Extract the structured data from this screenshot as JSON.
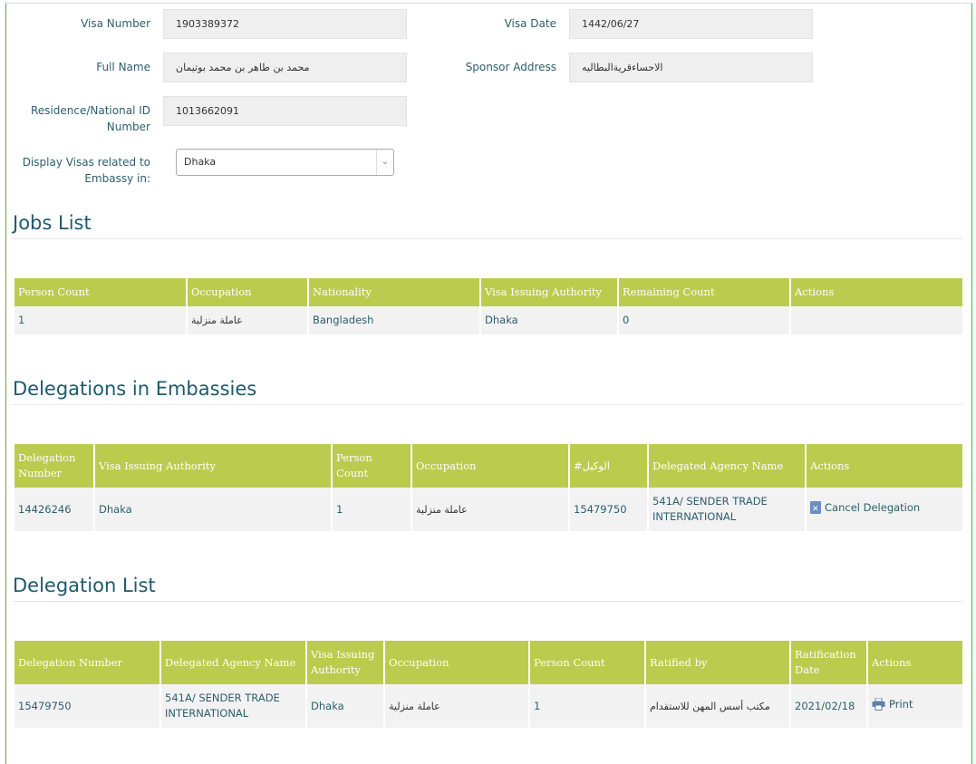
{
  "form": {
    "visa_number_label": "Visa Number",
    "visa_number": "1903389372",
    "visa_date_label": "Visa Date",
    "visa_date": "1442/06/27",
    "full_name_label": "Full Name",
    "full_name": "محمد بن طاهر بن محمد بوتيمان",
    "sponsor_address_label": "Sponsor Address",
    "sponsor_address": "الاحساءقريةالبطاليه",
    "residence_label_1": "Residence/National ID",
    "residence_label_2": "Number",
    "residence_id": "1013662091",
    "embassy_label_1": "Display Visas related to",
    "embassy_label_2": "Embassy in:",
    "embassy_selected": "Dhaka"
  },
  "jobs": {
    "title": "Jobs List",
    "headers": [
      "Person Count",
      "Occupation",
      "Nationality",
      "Visa Issuing Authority",
      "Remaining Count",
      "Actions"
    ],
    "rows": [
      [
        "1",
        "عاملة منزلية",
        "Bangladesh",
        "Dhaka",
        "0",
        ""
      ]
    ]
  },
  "embassy_delegations": {
    "title": "Delegations in Embassies",
    "headers": [
      "Delegation Number",
      "Visa Issuing Authority",
      "Person Count",
      "Occupation",
      "#الوكيل",
      "Delegated Agency Name",
      "Actions"
    ],
    "rows": [
      [
        "14426246",
        "Dhaka",
        "1",
        "عاملة منزلية",
        "15479750",
        "541A/ SENDER TRADE INTERNATIONAL",
        "Cancel Delegation"
      ]
    ]
  },
  "delegation_list": {
    "title": "Delegation List",
    "headers": [
      "Delegation Number",
      "Delegated Agency Name",
      "Visa Issuing Authority",
      "Occupation",
      "Person Count",
      "Ratified by",
      "Ratification Date",
      "Actions"
    ],
    "rows": [
      [
        "15479750",
        "541A/ SENDER TRADE INTERNATIONAL",
        "Dhaka",
        "عاملة منزلية",
        "1",
        "مكتب أسس المهن للاستقدام",
        "2021/02/18",
        "Print"
      ]
    ]
  },
  "icons": {
    "cancel": "cancel-delegation-icon",
    "print": "print-icon",
    "dropdown": "chevron-down-icon"
  }
}
